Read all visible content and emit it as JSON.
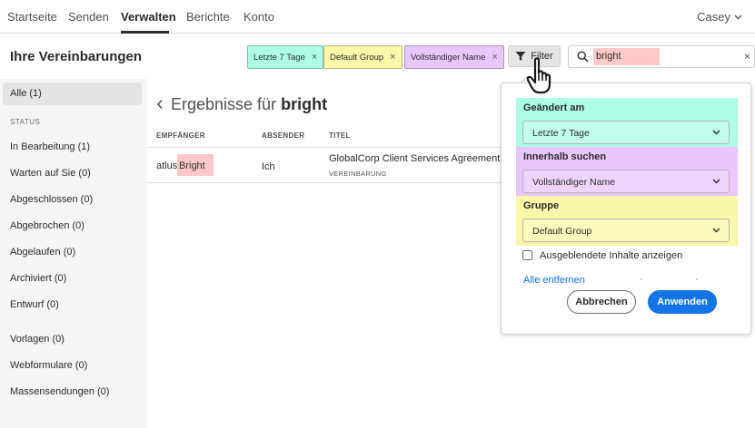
{
  "nav": {
    "tabs": [
      "Startseite",
      "Senden",
      "Verwalten",
      "Berichte",
      "Konto"
    ],
    "active": "Verwalten",
    "user": "Casey"
  },
  "header": {
    "title": "Ihre Vereinbarungen",
    "chips": [
      {
        "label": "Letzte 7 Tage",
        "color": "#aefbe6"
      },
      {
        "label": "Default Group",
        "color": "#fbf7a8"
      },
      {
        "label": "Vollständiger Name",
        "color": "#e9c6fb"
      }
    ],
    "filter_label": "Filter",
    "search_value": "bright",
    "search_highlight": "#ffc9c9"
  },
  "sidebar": {
    "all": "Alle (1)",
    "status_heading": "STATUS",
    "status_items": [
      "In Bearbeitung (1)",
      "Warten auf Sie (0)",
      "Abgeschlossen (0)",
      "Abgebrochen (0)",
      "Abgelaufen (0)",
      "Archiviert (0)",
      "Entwurf (0)"
    ],
    "other_items": [
      "Vorlagen (0)",
      "Webformulare (0)",
      "Massensendungen (0)"
    ]
  },
  "results": {
    "prefix": "Ergebnisse für",
    "term": "bright",
    "columns": [
      "EMPFÄNGER",
      "ABSENDER",
      "TITEL"
    ],
    "row": {
      "recipient_prefix": "atlus",
      "recipient_match": "Bright",
      "sender": "Ich",
      "title": "GlobalCorp Client Services Agreement",
      "type": "VEREINBARUNG"
    }
  },
  "filter_panel": {
    "groups": [
      {
        "label": "Geändert am",
        "value": "Letzte 7 Tage",
        "color": "#aefbe6"
      },
      {
        "label": "Innerhalb suchen",
        "value": "Vollständiger Name",
        "color": "#e9c6fb"
      },
      {
        "label": "Gruppe",
        "value": "Default Group",
        "color": "#fbf7a8"
      }
    ],
    "checkbox_label": "Ausgeblendete Inhalte anzeigen",
    "remove_all": "Alle entfernen",
    "cancel": "Abbrechen",
    "apply": "Anwenden"
  },
  "icons": [
    "back-chevron-icon",
    "funnel-icon",
    "search-icon",
    "close-icon",
    "chevron-down-icon",
    "hand-cursor-icon"
  ]
}
